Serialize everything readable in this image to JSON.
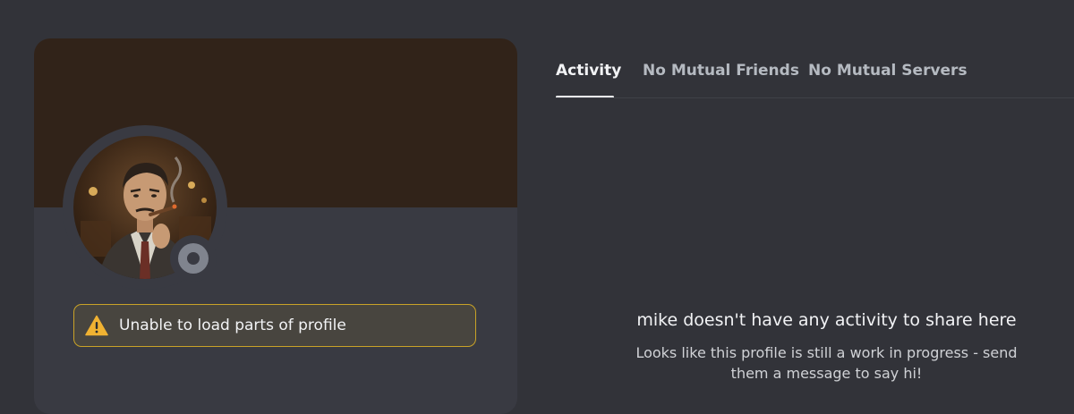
{
  "profile": {
    "avatar_icon": "user-portrait-avatar",
    "status_icon": "offline-status-icon",
    "banner_color": "#312319",
    "warning": {
      "icon": "warning-triangle-icon",
      "text": "Unable to load parts of profile",
      "border_color": "#c9a227"
    }
  },
  "tabs": [
    {
      "label": "Activity",
      "active": true
    },
    {
      "label": "No Mutual Friends",
      "active": false
    },
    {
      "label": "No Mutual Servers",
      "active": false
    }
  ],
  "activity": {
    "title": "mike doesn't have any activity to share here",
    "subtitle_line1": "Looks like this profile is still a work in progress - send",
    "subtitle_line2": "them a message to say hi!"
  }
}
